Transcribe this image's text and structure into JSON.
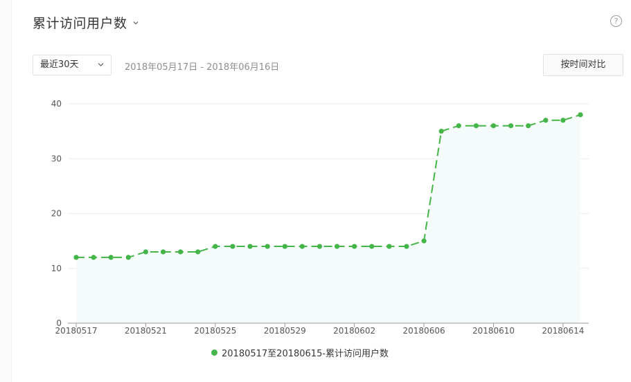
{
  "header": {
    "title": "累计访问用户数"
  },
  "controls": {
    "range_select": "最近30天",
    "date_range": "2018年05月17日 - 2018年06月16日",
    "compare_button": "按时间对比"
  },
  "colors": {
    "series": "#44b549",
    "area": "#f5fafa",
    "grid": "#ececec",
    "axis": "#9a9a9a"
  },
  "chart_data": {
    "type": "area",
    "x": [
      "20180517",
      "20180518",
      "20180519",
      "20180520",
      "20180521",
      "20180522",
      "20180523",
      "20180524",
      "20180525",
      "20180526",
      "20180527",
      "20180528",
      "20180529",
      "20180530",
      "20180531",
      "20180601",
      "20180602",
      "20180603",
      "20180604",
      "20180605",
      "20180606",
      "20180607",
      "20180608",
      "20180609",
      "20180610",
      "20180611",
      "20180612",
      "20180613",
      "20180614",
      "20180615"
    ],
    "x_tick_labels": [
      "20180517",
      "20180521",
      "20180525",
      "20180529",
      "20180602",
      "20180606",
      "20180610",
      "20180614"
    ],
    "series": [
      {
        "name": "20180517至20180615-累计访问用户数",
        "values": [
          12,
          12,
          12,
          12,
          13,
          13,
          13,
          13,
          14,
          14,
          14,
          14,
          14,
          14,
          14,
          14,
          14,
          14,
          14,
          14,
          15,
          35,
          36,
          36,
          36,
          36,
          36,
          37,
          37,
          38
        ]
      }
    ],
    "ylim": [
      0,
      40
    ],
    "y_ticks": [
      0,
      10,
      20,
      30,
      40
    ],
    "grid": true,
    "legend_position": "bottom"
  }
}
